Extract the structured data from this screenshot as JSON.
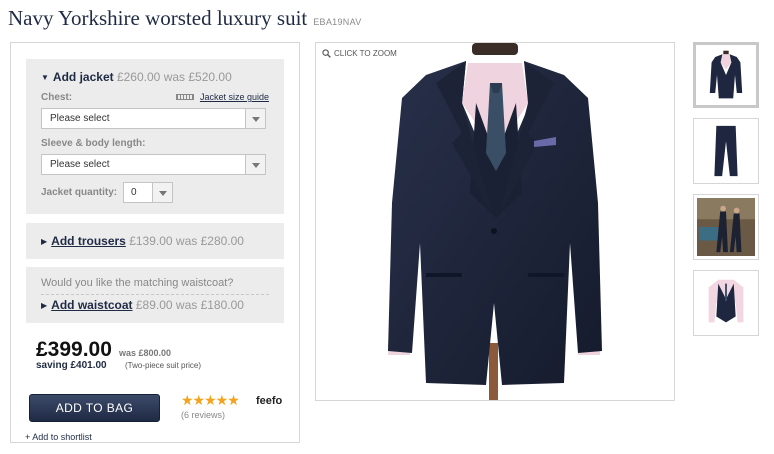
{
  "product": {
    "title": "Navy Yorkshire worsted luxury suit",
    "sku": "EBA19NAV"
  },
  "jacket": {
    "add_label": "Add jacket",
    "price": "£260.00",
    "was": "was £520.00",
    "chest_label": "Chest:",
    "size_guide_label": "Jacket size guide",
    "chest_value": "Please select",
    "sleeve_label": "Sleeve & body length:",
    "sleeve_value": "Please select",
    "quantity_label": "Jacket quantity:",
    "quantity_value": "0"
  },
  "trousers": {
    "add_label": "Add trousers",
    "price": "£139.00",
    "was": "was £280.00"
  },
  "waistcoat": {
    "question": "Would you like the matching waistcoat?",
    "add_label": "Add waistcoat",
    "price": "£89.00",
    "was": "was £180.00"
  },
  "pricing": {
    "total": "£399.00",
    "was": "was £800.00",
    "saving": "saving £401.00",
    "note": "(Two-piece suit price)"
  },
  "actions": {
    "add_to_bag": "ADD TO BAG",
    "shortlist": "+ Add to shortlist"
  },
  "reviews": {
    "stars": "★★★★★",
    "rating": 5,
    "count_label": "(6 reviews)",
    "provider": "feefo"
  },
  "image": {
    "zoom_label": "CLICK TO ZOOM"
  },
  "thumbnails": [
    {
      "name": "jacket-front"
    },
    {
      "name": "trousers"
    },
    {
      "name": "lifestyle"
    },
    {
      "name": "waistcoat"
    }
  ],
  "colors": {
    "navy": "#1f2a44",
    "star": "#f3a31c",
    "panel": "#ececec"
  }
}
